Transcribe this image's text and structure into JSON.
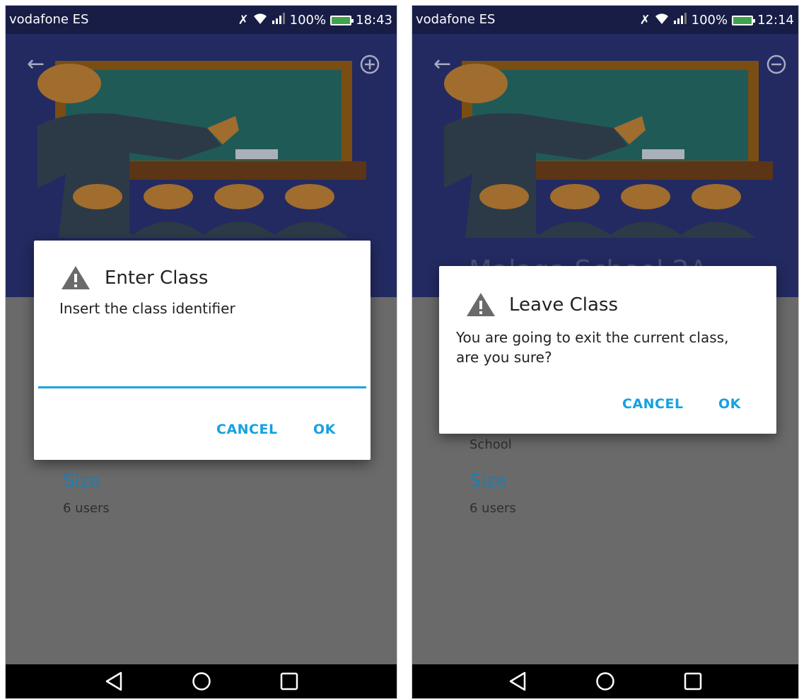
{
  "screens": [
    {
      "status": {
        "carrier": "vodafone ES",
        "battery": "100%",
        "time": "18:43"
      },
      "action_icon": "add-circle-icon",
      "info": {
        "size_label": "Size",
        "size_value": "6 users"
      },
      "dialog": {
        "title": "Enter Class",
        "message": "Insert the class identifier",
        "input_value": "",
        "cancel_label": "CANCEL",
        "ok_label": "OK"
      }
    },
    {
      "status": {
        "carrier": "vodafone ES",
        "battery": "100%",
        "time": "12:14"
      },
      "action_icon": "remove-circle-icon",
      "class_name": "Malaga School 2A",
      "info": {
        "partial_value": "School",
        "size_label": "Size",
        "size_value": "6 users"
      },
      "dialog": {
        "title": "Leave Class",
        "message_line1": "You are going to exit the current class,",
        "message_line2": "are you sure?",
        "cancel_label": "CANCEL",
        "ok_label": "OK"
      }
    }
  ],
  "colors": {
    "accent": "#15a1e0",
    "header": "#232a61",
    "statusbar": "#181d46",
    "scrim": "#6a6a6a"
  }
}
